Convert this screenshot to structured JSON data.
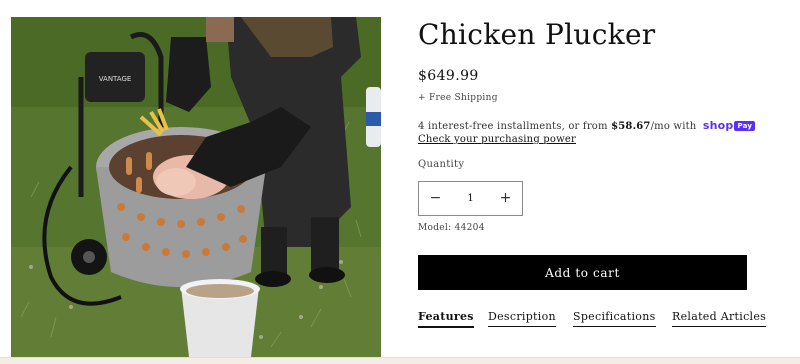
{
  "product": {
    "title": "Chicken Plucker",
    "price": "$649.99",
    "shipping": "+ Free Shipping",
    "installments": {
      "prefix": "4 interest-free installments, or from ",
      "amount": "$58.67",
      "suffix": "/mo with",
      "provider": "shop",
      "provider_badge": "Pay",
      "link": "Check your purchasing power"
    },
    "quantity": {
      "label": "Quantity",
      "value": "1",
      "minus_icon": "minus-icon",
      "plus_icon": "plus-icon"
    },
    "model": "Model: 44204",
    "add_to_cart": "Add to cart"
  },
  "tabs": [
    {
      "label": "Features",
      "active": true
    },
    {
      "label": "Description",
      "active": false
    },
    {
      "label": "Specifications",
      "active": false
    },
    {
      "label": "Related Articles",
      "active": false
    }
  ],
  "photo": {
    "brand_text": "VANTAGE"
  },
  "colors": {
    "button": "#000000",
    "shop_pay": "#5a31f4",
    "text": "#121212"
  }
}
